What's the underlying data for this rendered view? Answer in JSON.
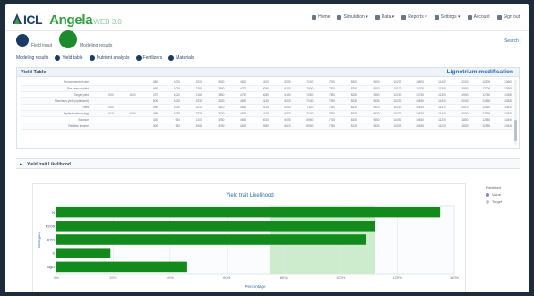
{
  "header": {
    "logo_icl": "ICL",
    "app_name": "Angela",
    "app_version": "WEB 3.0",
    "nav": [
      {
        "label": "Home",
        "icon": "home-icon"
      },
      {
        "label": "Simulation ▾",
        "icon": "grid-icon"
      },
      {
        "label": "Data ▾",
        "icon": "database-icon"
      },
      {
        "label": "Reports ▾",
        "icon": "report-icon"
      },
      {
        "label": "Settings ▾",
        "icon": "gear-icon"
      },
      {
        "label": "Account",
        "icon": "user-icon"
      },
      {
        "label": "Sign out",
        "icon": "logout-icon"
      }
    ]
  },
  "stepper": {
    "step1": "Field input",
    "step2": "Modeling results"
  },
  "search_link": "Search ›",
  "subtabs": [
    {
      "label": "Modeling results",
      "dot": false
    },
    {
      "label": "Yield table",
      "dot": true
    },
    {
      "label": "Nutrient analysis",
      "dot": true
    },
    {
      "label": "Fertilizers",
      "dot": true
    },
    {
      "label": "Materials",
      "dot": true
    }
  ],
  "panel": {
    "title": "Yield Table",
    "right_title": "Lignotrium modification",
    "rows": [
      {
        "label": "Recommended rate",
        "cells": [
          "",
          "",
          "480",
          "1020",
          "2200",
          "3400",
          "4800",
          "5100",
          "6200",
          "7100",
          "7900",
          "8300",
          "9500",
          "10200",
          "10800",
          "11400",
          "12000",
          "12800",
          "13600"
        ]
      },
      {
        "label": "Pre-season yield",
        "cells": [
          "",
          "",
          "460",
          "1000",
          "2150",
          "3300",
          "4700",
          "5050",
          "6100",
          "7000",
          "7800",
          "8200",
          "9400",
          "10100",
          "10700",
          "11300",
          "11900",
          "12700",
          "13500"
        ]
      },
      {
        "label": "Target yield",
        "cells": [
          "1000",
          "1050",
          "470",
          "1010",
          "2180",
          "3350",
          "4750",
          "5080",
          "6150",
          "7050",
          "7850",
          "8250",
          "9450",
          "10150",
          "10750",
          "11350",
          "11950",
          "12750",
          "13550"
        ]
      },
      {
        "label": "Maximum yield (optimized)",
        "cells": [
          "",
          "",
          "500",
          "1040",
          "2230",
          "3430",
          "4830",
          "5130",
          "6230",
          "7130",
          "7930",
          "8330",
          "9530",
          "10230",
          "10830",
          "11430",
          "12030",
          "12830",
          "13630"
        ]
      },
      {
        "label": "Yield",
        "cells": [
          "1000",
          "",
          "490",
          "1030",
          "2210",
          "3410",
          "4810",
          "5110",
          "6210",
          "7110",
          "7910",
          "8310",
          "9510",
          "10210",
          "10810",
          "11410",
          "12010",
          "12810",
          "13610"
        ]
      },
      {
        "label": "Applied nutrient (kg)",
        "cells": [
          "1010",
          "1030",
          "495",
          "1035",
          "2220",
          "3420",
          "4820",
          "5120",
          "6220",
          "7120",
          "7920",
          "8320",
          "9520",
          "10220",
          "10820",
          "11420",
          "12020",
          "12820",
          "13620"
        ]
      },
      {
        "label": "Balance",
        "cells": [
          "",
          "",
          "420",
          "960",
          "2100",
          "3250",
          "4650",
          "5000",
          "6050",
          "6950",
          "7750",
          "8150",
          "9350",
          "10050",
          "10650",
          "11250",
          "11850",
          "12650",
          "13450"
        ]
      },
      {
        "label": "Relative income",
        "cells": [
          "",
          "",
          "400",
          "940",
          "2080",
          "3230",
          "4630",
          "4980",
          "6030",
          "6930",
          "7730",
          "8130",
          "9330",
          "10030",
          "10630",
          "11230",
          "11830",
          "12630",
          "13430"
        ]
      }
    ]
  },
  "collapsed_section": "Yield trait Likelihood",
  "chart_data": {
    "type": "bar",
    "orientation": "horizontal",
    "title": "Yield trait Likelihood",
    "xlabel": "Percentage",
    "ylabel": "Category",
    "categories": [
      "N",
      "P2O5",
      "K2O",
      "S",
      "MgO"
    ],
    "values": [
      13500,
      11200,
      10900,
      1900,
      4600
    ],
    "xlim": [
      0,
      14000
    ],
    "xticks": [
      "0%",
      "20%",
      "40%",
      "60%",
      "80%",
      "100%",
      "120%",
      "140%"
    ],
    "highlight_range": [
      7500,
      11200
    ],
    "bar_color": "#138a1c",
    "highlight_color": "#cdeccd",
    "grid": true,
    "legend": {
      "title": "Predicted",
      "placement": "right",
      "items": [
        {
          "label": "Value",
          "color": "#8e7cc3"
        },
        {
          "label": "Target",
          "color": "#c9c9d6"
        }
      ]
    }
  }
}
